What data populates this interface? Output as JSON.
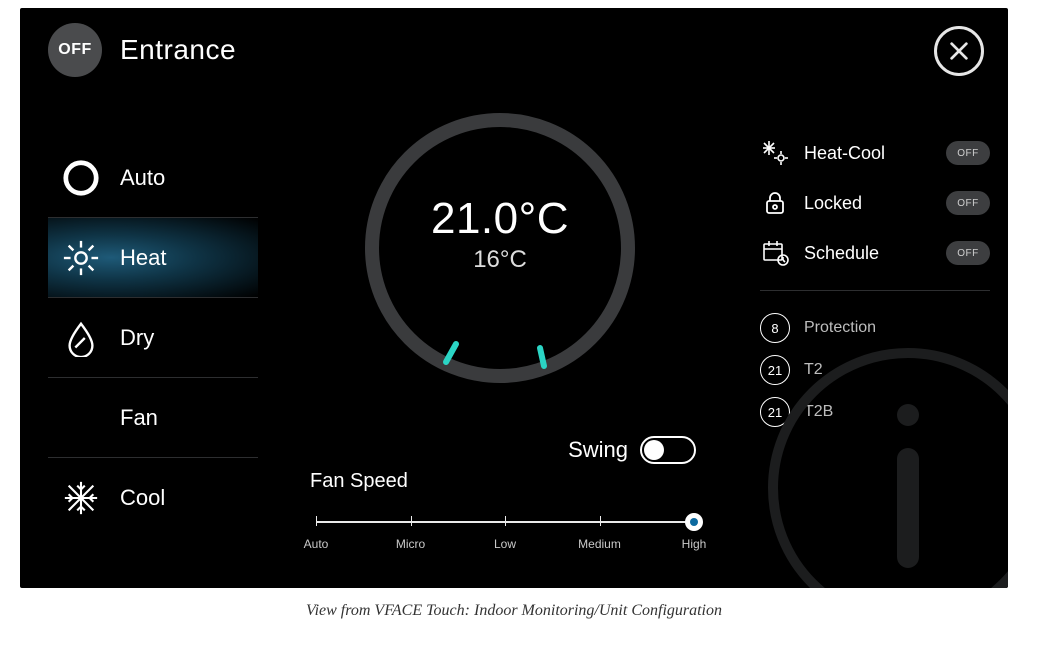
{
  "header": {
    "power_state": "OFF",
    "zone_name": "Entrance"
  },
  "modes": [
    {
      "key": "auto",
      "label": "Auto",
      "selected": false
    },
    {
      "key": "heat",
      "label": "Heat",
      "selected": true
    },
    {
      "key": "dry",
      "label": "Dry",
      "selected": false
    },
    {
      "key": "fan",
      "label": "Fan",
      "selected": false
    },
    {
      "key": "cool",
      "label": "Cool",
      "selected": false
    }
  ],
  "temperature": {
    "setpoint_display": "21.0°C",
    "current_display": "16°C",
    "setpoint_value": 21.0,
    "current_value": 16
  },
  "swing": {
    "label": "Swing",
    "on": false
  },
  "fan_speed": {
    "label": "Fan Speed",
    "options": [
      "Auto",
      "Micro",
      "Low",
      "Medium",
      "High"
    ],
    "index": 4
  },
  "toggles": [
    {
      "key": "heatcool",
      "label": "Heat-Cool",
      "state": "OFF"
    },
    {
      "key": "locked",
      "label": "Locked",
      "state": "OFF"
    },
    {
      "key": "schedule",
      "label": "Schedule",
      "state": "OFF"
    }
  ],
  "readings": [
    {
      "key": "protection",
      "value": "8",
      "label": "Protection"
    },
    {
      "key": "t2",
      "value": "21",
      "label": "T2"
    },
    {
      "key": "t2b",
      "value": "21",
      "label": "T2B"
    }
  ],
  "caption": "View from VFACE Touch: Indoor Monitoring/Unit Configuration"
}
